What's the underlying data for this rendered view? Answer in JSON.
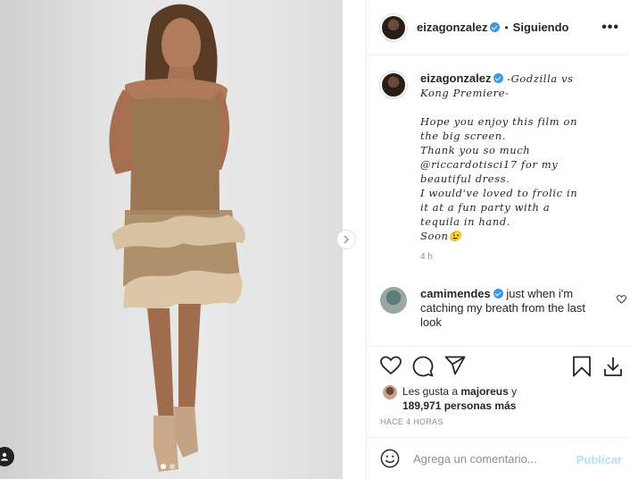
{
  "post": {
    "username": "eizagonzalez",
    "separator": "•",
    "follow_status": "Siguiendo",
    "more_label": "•••"
  },
  "caption": {
    "username": "eizagonzalez",
    "lines": [
      "-Godzilla vs",
      "Kong Premiere-",
      "",
      "Hope you enjoy this film on",
      "the big screen.",
      "Thank you so much",
      "@riccardotisci17 for my",
      "beautiful dress.",
      "I would've loved to frolic in",
      "it at a fun party with a",
      "tequila in hand.",
      "Soon😉"
    ],
    "time": "4 h"
  },
  "comment": {
    "username": "camimendes",
    "text": "just when i'm catching my breath from the last look"
  },
  "likes": {
    "prefix": "Les gusta a",
    "user": "majoreus",
    "joiner": "y",
    "count": "189,971 personas más"
  },
  "timestamp": "HACE 4 HORAS",
  "add_comment": {
    "placeholder": "Agrega un comentario...",
    "publish_label": "Publicar"
  },
  "carousel": {
    "slides": 2,
    "active_index": 0
  },
  "colors": {
    "verified": "#3897f0",
    "publish_disabled": "#b2dffc",
    "border": "#efefef",
    "muted": "#8e8e8e"
  },
  "icons": [
    "heart-icon",
    "comment-icon",
    "share-icon",
    "bookmark-icon",
    "download-icon",
    "emoji-icon",
    "chevron-right-icon",
    "user-tag-icon",
    "more-icon",
    "verified-icon"
  ]
}
